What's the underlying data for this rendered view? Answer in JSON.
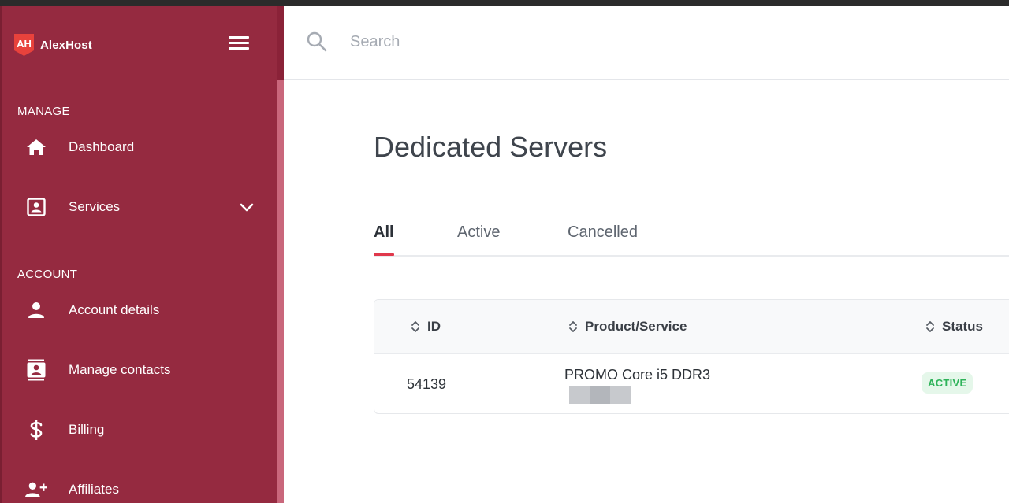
{
  "brand": {
    "name": "AlexHost",
    "logo_text": "AH"
  },
  "sidebar": {
    "sections": [
      {
        "label": "MANAGE"
      },
      {
        "label": "ACCOUNT"
      }
    ],
    "items": [
      {
        "label": "Dashboard",
        "icon": "home-icon"
      },
      {
        "label": "Services",
        "icon": "id-card-icon",
        "expandable": true
      },
      {
        "label": "Account details",
        "icon": "person-icon"
      },
      {
        "label": "Manage contacts",
        "icon": "contacts-icon"
      },
      {
        "label": "Billing",
        "icon": "dollar-icon"
      },
      {
        "label": "Affiliates",
        "icon": "person-add-icon"
      }
    ]
  },
  "search": {
    "placeholder": "Search",
    "value": ""
  },
  "page": {
    "title": "Dedicated Servers"
  },
  "tabs": [
    {
      "label": "All",
      "active": true
    },
    {
      "label": "Active",
      "active": false
    },
    {
      "label": "Cancelled",
      "active": false
    }
  ],
  "table": {
    "columns": [
      "ID",
      "Product/Service",
      "Status"
    ],
    "rows": [
      {
        "id": "54139",
        "product": "PROMO Core i5 DDR3",
        "status": "ACTIVE"
      }
    ]
  },
  "colors": {
    "sidebar_bg": "#952a40",
    "accent_underline": "#e0384c",
    "status_active_bg": "#e5f7ea",
    "status_active_text": "#2fb35a",
    "logo_red": "#e8423c"
  }
}
